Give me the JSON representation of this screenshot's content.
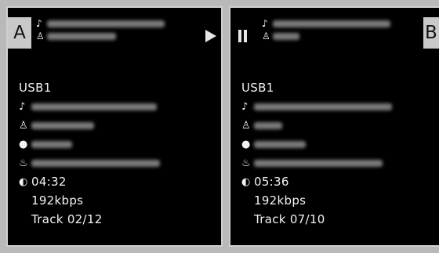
{
  "deck_a": {
    "badge": "A",
    "source": "USB1",
    "time": "04:32",
    "bitrate": "192kbps",
    "track": "Track 02/12"
  },
  "deck_b": {
    "badge": "B",
    "source": "USB1",
    "time": "05:36",
    "bitrate": "192kbps",
    "track": "Track 07/10"
  },
  "icons": {
    "note": "♪",
    "artist": "♙",
    "album": "●",
    "genre": "♨",
    "clock": "◐"
  },
  "colors": {
    "background": "#b9b9b9",
    "panel": "#000000",
    "text": "#f2f2f2",
    "badge": "#c9c9c9"
  }
}
